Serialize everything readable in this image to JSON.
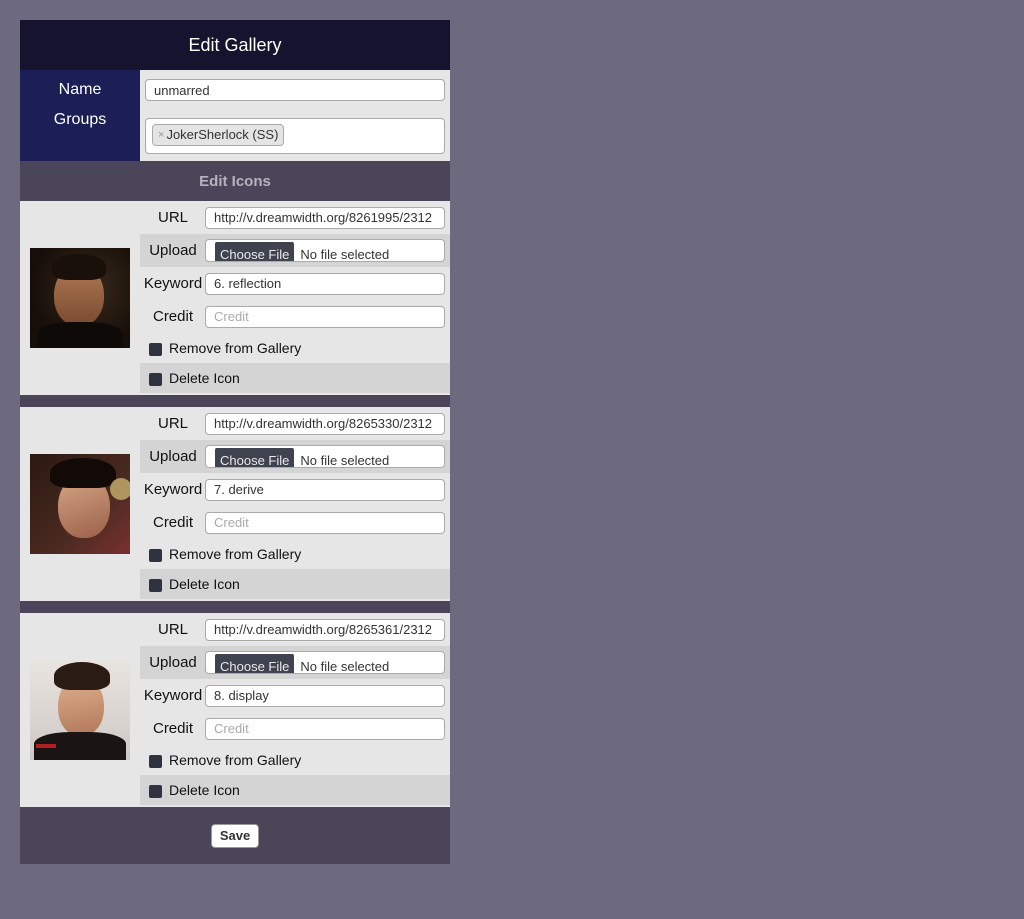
{
  "title": "Edit Gallery",
  "name_label": "Name",
  "name_value": "unmarred",
  "groups_label": "Groups",
  "groups": [
    {
      "label": "JokerSherlock (SS)",
      "remove_glyph": "×"
    }
  ],
  "section_header": "Edit Icons",
  "field_labels": {
    "url": "URL",
    "upload": "Upload",
    "keyword": "Keyword",
    "credit": "Credit"
  },
  "credit_placeholder": "Credit",
  "upload_button": "Choose File",
  "upload_status": "No file selected",
  "remove_label": "Remove from Gallery",
  "delete_label": "Delete Icon",
  "icons": [
    {
      "url": "http://v.dreamwidth.org/8261995/2312",
      "keyword": "6. reflection",
      "credit": ""
    },
    {
      "url": "http://v.dreamwidth.org/8265330/2312",
      "keyword": "7. derive",
      "credit": ""
    },
    {
      "url": "http://v.dreamwidth.org/8265361/2312",
      "keyword": "8. display",
      "credit": ""
    }
  ],
  "save_label": "Save",
  "colors": {
    "page_bg": "#6d6a80",
    "title_bg": "#15132e",
    "label_bg": "#1b1f56",
    "section_bg": "#4a4559",
    "row_bg": "#e6e6e6",
    "row_alt_bg": "#d4d4d4"
  }
}
